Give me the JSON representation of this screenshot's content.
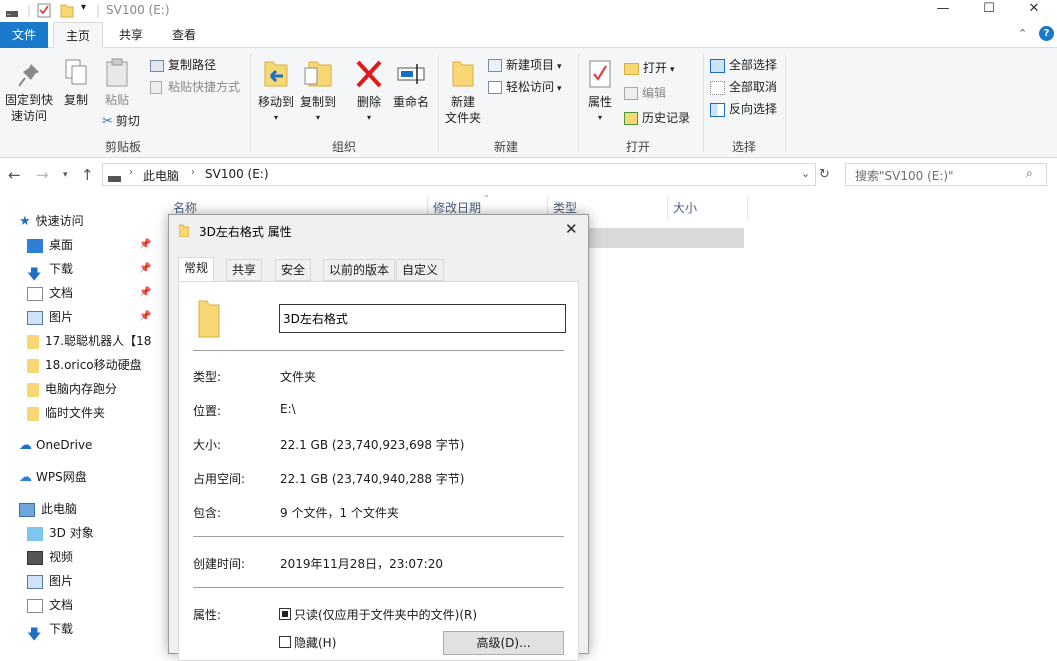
{
  "window": {
    "title": "SV100 (E:)",
    "controls": [
      "—",
      "☐",
      "✕"
    ]
  },
  "ribbon_tabs": [
    {
      "label": "文件"
    },
    {
      "label": "主页"
    },
    {
      "label": "共享"
    },
    {
      "label": "查看"
    }
  ],
  "ribbon": {
    "clipboard": {
      "pin_label_1": "固定到快",
      "pin_label_2": "速访问",
      "copy": "复制",
      "paste": "粘贴",
      "copy_path": "复制路径",
      "paste_shortcut": "粘贴快捷方式",
      "cut": "剪切",
      "group": "剪贴板"
    },
    "organize": {
      "move_to": "移动到",
      "copy_to": "复制到",
      "delete": "删除",
      "rename": "重命名",
      "group": "组织"
    },
    "new": {
      "new_folder_1": "新建",
      "new_folder_2": "文件夹",
      "new_item": "新建项目",
      "easy_access": "轻松访问",
      "group": "新建"
    },
    "open": {
      "properties": "属性",
      "open": "打开",
      "edit": "编辑",
      "history": "历史记录",
      "group": "打开"
    },
    "select": {
      "select_all": "全部选择",
      "select_none": "全部取消",
      "invert": "反向选择",
      "group": "选择"
    }
  },
  "address": {
    "crumbs": [
      "此电脑",
      "SV100 (E:)"
    ],
    "search_placeholder": "搜索\"SV100 (E:)\""
  },
  "nav_pane": {
    "quick_access": "快速访问",
    "items": [
      {
        "label": "桌面",
        "pinned": true
      },
      {
        "label": "下载",
        "pinned": true
      },
      {
        "label": "文档",
        "pinned": true
      },
      {
        "label": "图片",
        "pinned": true
      },
      {
        "label": "17.聪聪机器人【18"
      },
      {
        "label": "18.orico移动硬盘"
      },
      {
        "label": "电脑内存跑分"
      },
      {
        "label": "临时文件夹"
      }
    ],
    "onedrive": "OneDrive",
    "wps": "WPS网盘",
    "this_pc": "此电脑",
    "pc_items": [
      {
        "label": "3D 对象"
      },
      {
        "label": "视频"
      },
      {
        "label": "图片"
      },
      {
        "label": "文档"
      },
      {
        "label": "下载"
      }
    ]
  },
  "columns": [
    "名称",
    "修改日期",
    "类型",
    "大小"
  ],
  "dialog": {
    "title": "3D左右格式 属性",
    "tabs": [
      "常规",
      "共享",
      "安全",
      "以前的版本",
      "自定义"
    ],
    "name_value": "3D左右格式",
    "rows": {
      "type_label": "类型:",
      "type_value": "文件夹",
      "location_label": "位置:",
      "location_value": "E:\\",
      "size_label": "大小:",
      "size_value": "22.1 GB (23,740,923,698 字节)",
      "disk_label": "占用空间:",
      "disk_value": "22.1 GB (23,740,940,288 字节)",
      "contains_label": "包含:",
      "contains_value": "9 个文件，1 个文件夹",
      "created_label": "创建时间:",
      "created_value": "2019年11月28日，23:07:20",
      "attr_label": "属性:",
      "readonly": "只读(仅应用于文件夹中的文件)(R)",
      "hidden": "隐藏(H)",
      "advanced": "高级(D)..."
    }
  }
}
